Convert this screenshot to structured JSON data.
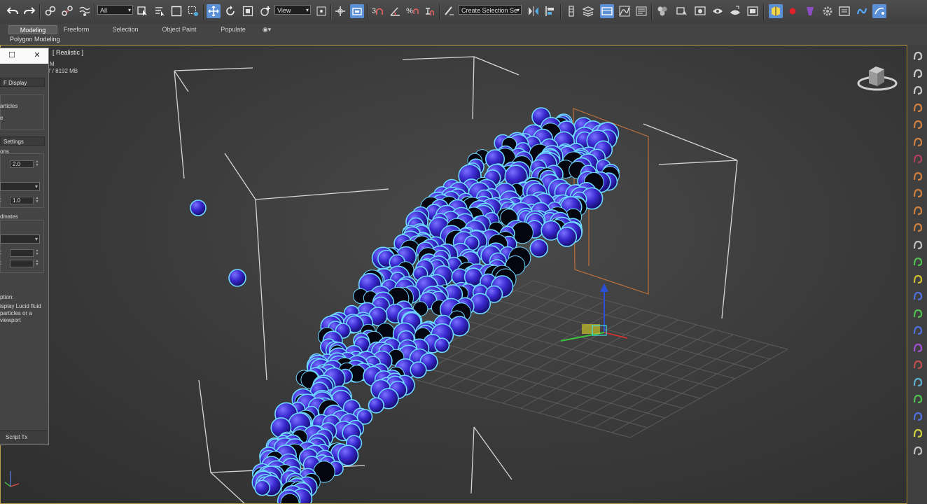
{
  "toolbar": {
    "selection_filter": "All",
    "ref_coord_system": "View",
    "named_selection": "Create Selection Se",
    "snap_label": "3",
    "angle_snap_label": "%"
  },
  "ribbon": {
    "tabs": [
      "Modeling",
      "Freeform",
      "Selection",
      "Object Paint",
      "Populate"
    ],
    "active_tab": "Modeling",
    "panel_label": "Polygon Modeling"
  },
  "viewport": {
    "label": "[ Realistic ]",
    "stat_line1": "M",
    "stat_line2": "7 / 8192 MB",
    "accent_border": "#b8a04a",
    "particle_color": "#3a2ad0",
    "particle_outline": "#6fd8ff"
  },
  "panel": {
    "rollout_display": "F Display",
    "text_particles": "articles",
    "text_e": "e",
    "rollout_settings": "Settings",
    "text_ons": "ons",
    "spinner1": "2.0",
    "spinner2": "1.0",
    "text_dinates": "dinates",
    "text_ption": "ption:",
    "desc_line1": "isplay Lucid fluid",
    "desc_line2": "particles or a",
    "desc_line3": "viewport",
    "script_bar": "Script Tx"
  },
  "icons": {
    "undo": "undo-icon",
    "redo": "redo-icon",
    "link": "link-icon",
    "unlink": "unlink-icon",
    "bind": "bind-space-warp-icon",
    "select": "select-object-icon",
    "select_by_name": "select-by-name-icon",
    "rect_region": "rectangular-region-icon",
    "window_crossing": "window-crossing-icon",
    "move": "move-icon",
    "rotate": "rotate-icon",
    "scale": "scale-icon",
    "place": "place-icon"
  }
}
